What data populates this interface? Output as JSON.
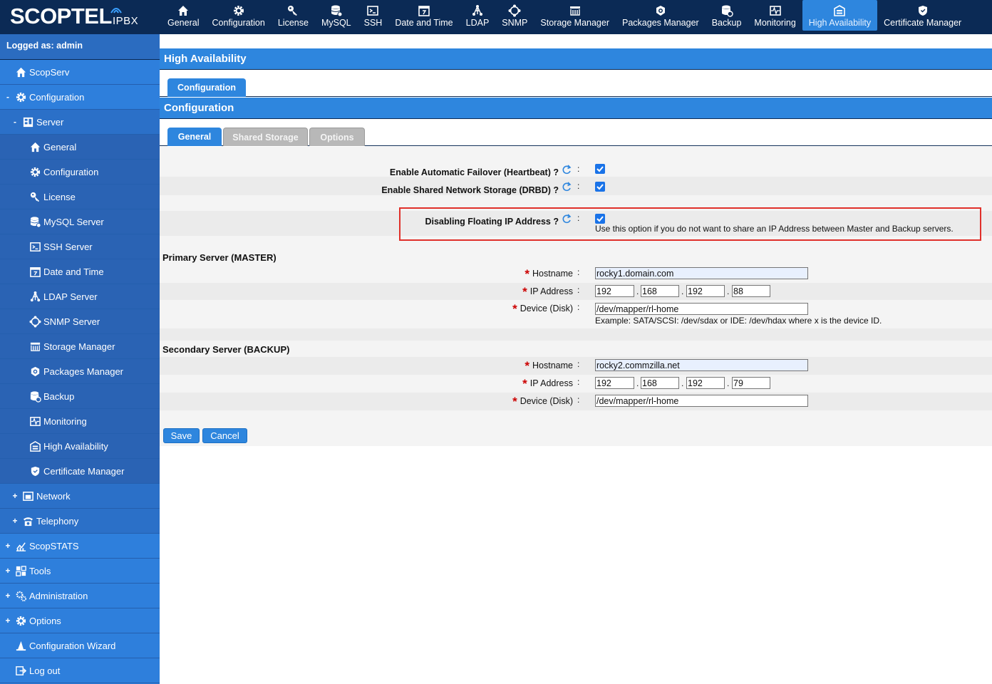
{
  "logo": {
    "main": "SCOPTEL",
    "sub": "IPBX"
  },
  "topnav": [
    {
      "label": "General",
      "icon": "home-icon"
    },
    {
      "label": "Configuration",
      "icon": "gear-icon"
    },
    {
      "label": "License",
      "icon": "key-icon"
    },
    {
      "label": "MySQL",
      "icon": "database-icon"
    },
    {
      "label": "SSH",
      "icon": "terminal-icon"
    },
    {
      "label": "Date and Time",
      "icon": "calendar-icon"
    },
    {
      "label": "LDAP",
      "icon": "ldap-tree-icon"
    },
    {
      "label": "SNMP",
      "icon": "snmp-icon"
    },
    {
      "label": "Storage Manager",
      "icon": "storage-icon"
    },
    {
      "label": "Packages Manager",
      "icon": "package-icon"
    },
    {
      "label": "Backup",
      "icon": "backup-icon"
    },
    {
      "label": "Monitoring",
      "icon": "monitoring-icon"
    },
    {
      "label": "High Availability",
      "icon": "high-availability-icon"
    },
    {
      "label": "Certificate Manager",
      "icon": "shield-icon"
    }
  ],
  "sidebar": {
    "logged": "Logged as: admin",
    "items": [
      {
        "label": "ScopServ",
        "marker": ""
      },
      {
        "label": "Configuration",
        "marker": "-"
      },
      {
        "label": "Server",
        "marker": "-"
      },
      {
        "label": "General",
        "marker": ""
      },
      {
        "label": "Configuration",
        "marker": ""
      },
      {
        "label": "License",
        "marker": ""
      },
      {
        "label": "MySQL Server",
        "marker": ""
      },
      {
        "label": "SSH Server",
        "marker": ""
      },
      {
        "label": "Date and Time",
        "marker": ""
      },
      {
        "label": "LDAP Server",
        "marker": ""
      },
      {
        "label": "SNMP Server",
        "marker": ""
      },
      {
        "label": "Storage Manager",
        "marker": ""
      },
      {
        "label": "Packages Manager",
        "marker": ""
      },
      {
        "label": "Backup",
        "marker": ""
      },
      {
        "label": "Monitoring",
        "marker": ""
      },
      {
        "label": "High Availability",
        "marker": ""
      },
      {
        "label": "Certificate Manager",
        "marker": ""
      },
      {
        "label": "Network",
        "marker": "+"
      },
      {
        "label": "Telephony",
        "marker": "+"
      },
      {
        "label": "ScopSTATS",
        "marker": "+"
      },
      {
        "label": "Tools",
        "marker": "+"
      },
      {
        "label": "Administration",
        "marker": "+"
      },
      {
        "label": "Options",
        "marker": "+"
      },
      {
        "label": "Configuration Wizard",
        "marker": ""
      },
      {
        "label": "Log out",
        "marker": ""
      }
    ]
  },
  "page": {
    "title": "High Availability",
    "outer_tab": "Configuration",
    "section_title": "Configuration",
    "tabs": [
      "General",
      "Shared Storage",
      "Options"
    ]
  },
  "form": {
    "failover_label": "Enable Automatic Failover (Heartbeat) ?",
    "failover_checked": true,
    "drbd_label": "Enable Shared Network Storage (DRBD) ?",
    "drbd_checked": true,
    "floating_label": "Disabling Floating IP Address ?",
    "floating_checked": true,
    "floating_hint": "Use this option if you do not want to share an IP Address between Master and Backup servers.",
    "colon": ":",
    "dot": ".",
    "required_mark": "*",
    "primary": {
      "title": "Primary Server (MASTER)",
      "hostname_label": "Hostname",
      "hostname": "rocky1.domain.com",
      "ip_label": "IP Address",
      "ip": [
        "192",
        "168",
        "192",
        "88"
      ],
      "device_label": "Device (Disk)",
      "device": "/dev/mapper/rl-home",
      "device_hint": "Example: SATA/SCSI: /dev/sdax or IDE: /dev/hdax where x is the device ID."
    },
    "secondary": {
      "title": "Secondary Server (BACKUP)",
      "hostname_label": "Hostname",
      "hostname": "rocky2.commzilla.net",
      "ip_label": "IP Address",
      "ip": [
        "192",
        "168",
        "192",
        "79"
      ],
      "device_label": "Device (Disk)",
      "device": "/dev/mapper/rl-home"
    },
    "save_label": "Save",
    "cancel_label": "Cancel"
  },
  "colors": {
    "navy": "#0b2a55",
    "blue": "#2e86de",
    "highlight": "#e0302a"
  }
}
